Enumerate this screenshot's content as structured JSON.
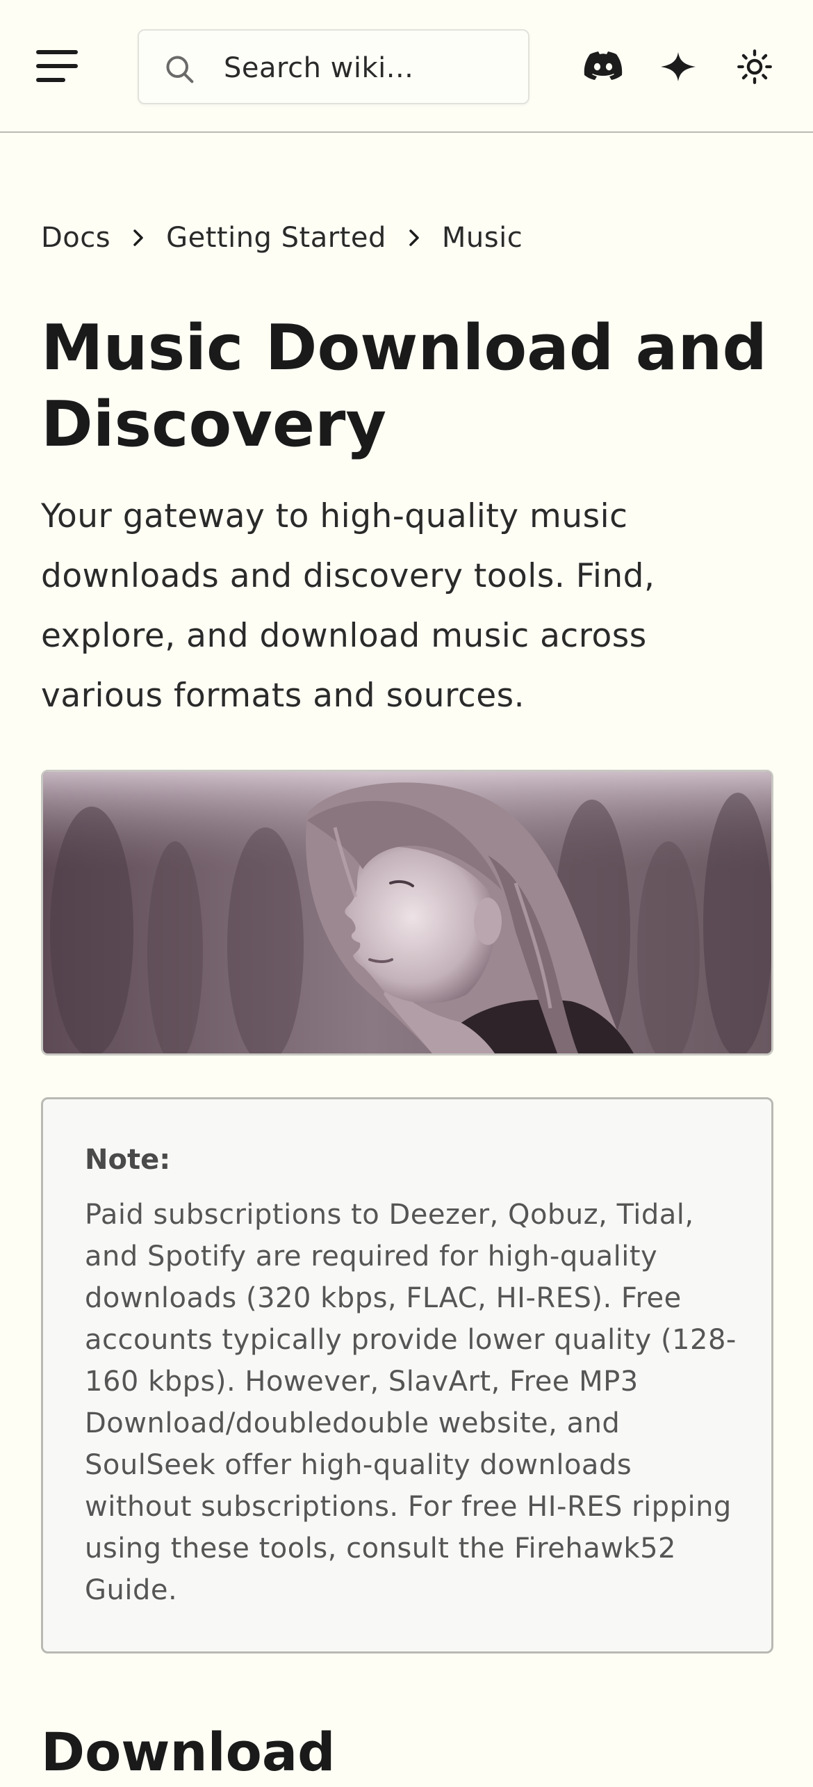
{
  "header": {
    "menu_icon": "hamburger-menu-icon",
    "search_placeholder": "Search wiki...",
    "search_icon": "search-icon",
    "icons": [
      "discord-icon",
      "sparkle-star-icon",
      "sun-theme-icon"
    ]
  },
  "breadcrumb": {
    "items": [
      "Docs",
      "Getting Started",
      "Music"
    ],
    "separator_icon": "chevron-right-icon"
  },
  "page": {
    "title": "Music Download and Discovery",
    "intro": "Your gateway to high-quality music downloads and discovery tools. Find, explore, and download music across various formats and sources."
  },
  "note": {
    "label": "Note:",
    "text": "Paid subscriptions to Deezer, Qobuz, Tidal, and Spotify are required for high-quality downloads (320 kbps, FLAC, HI-RES). Free accounts typically provide lower quality (128-160 kbps). However, SlavArt, Free MP3 Download/doubledouble website, and SoulSeek offer high-quality downloads without subscriptions. For free HI-RES ripping using these tools, consult the Firehawk52 Guide."
  },
  "next_section": {
    "heading": "Download"
  },
  "colors": {
    "background": "#fefef5",
    "text": "#1c1c1c",
    "border": "#b9b9b3",
    "note_bg": "#f8f8f6",
    "banner_tint": "#6e5b64"
  }
}
